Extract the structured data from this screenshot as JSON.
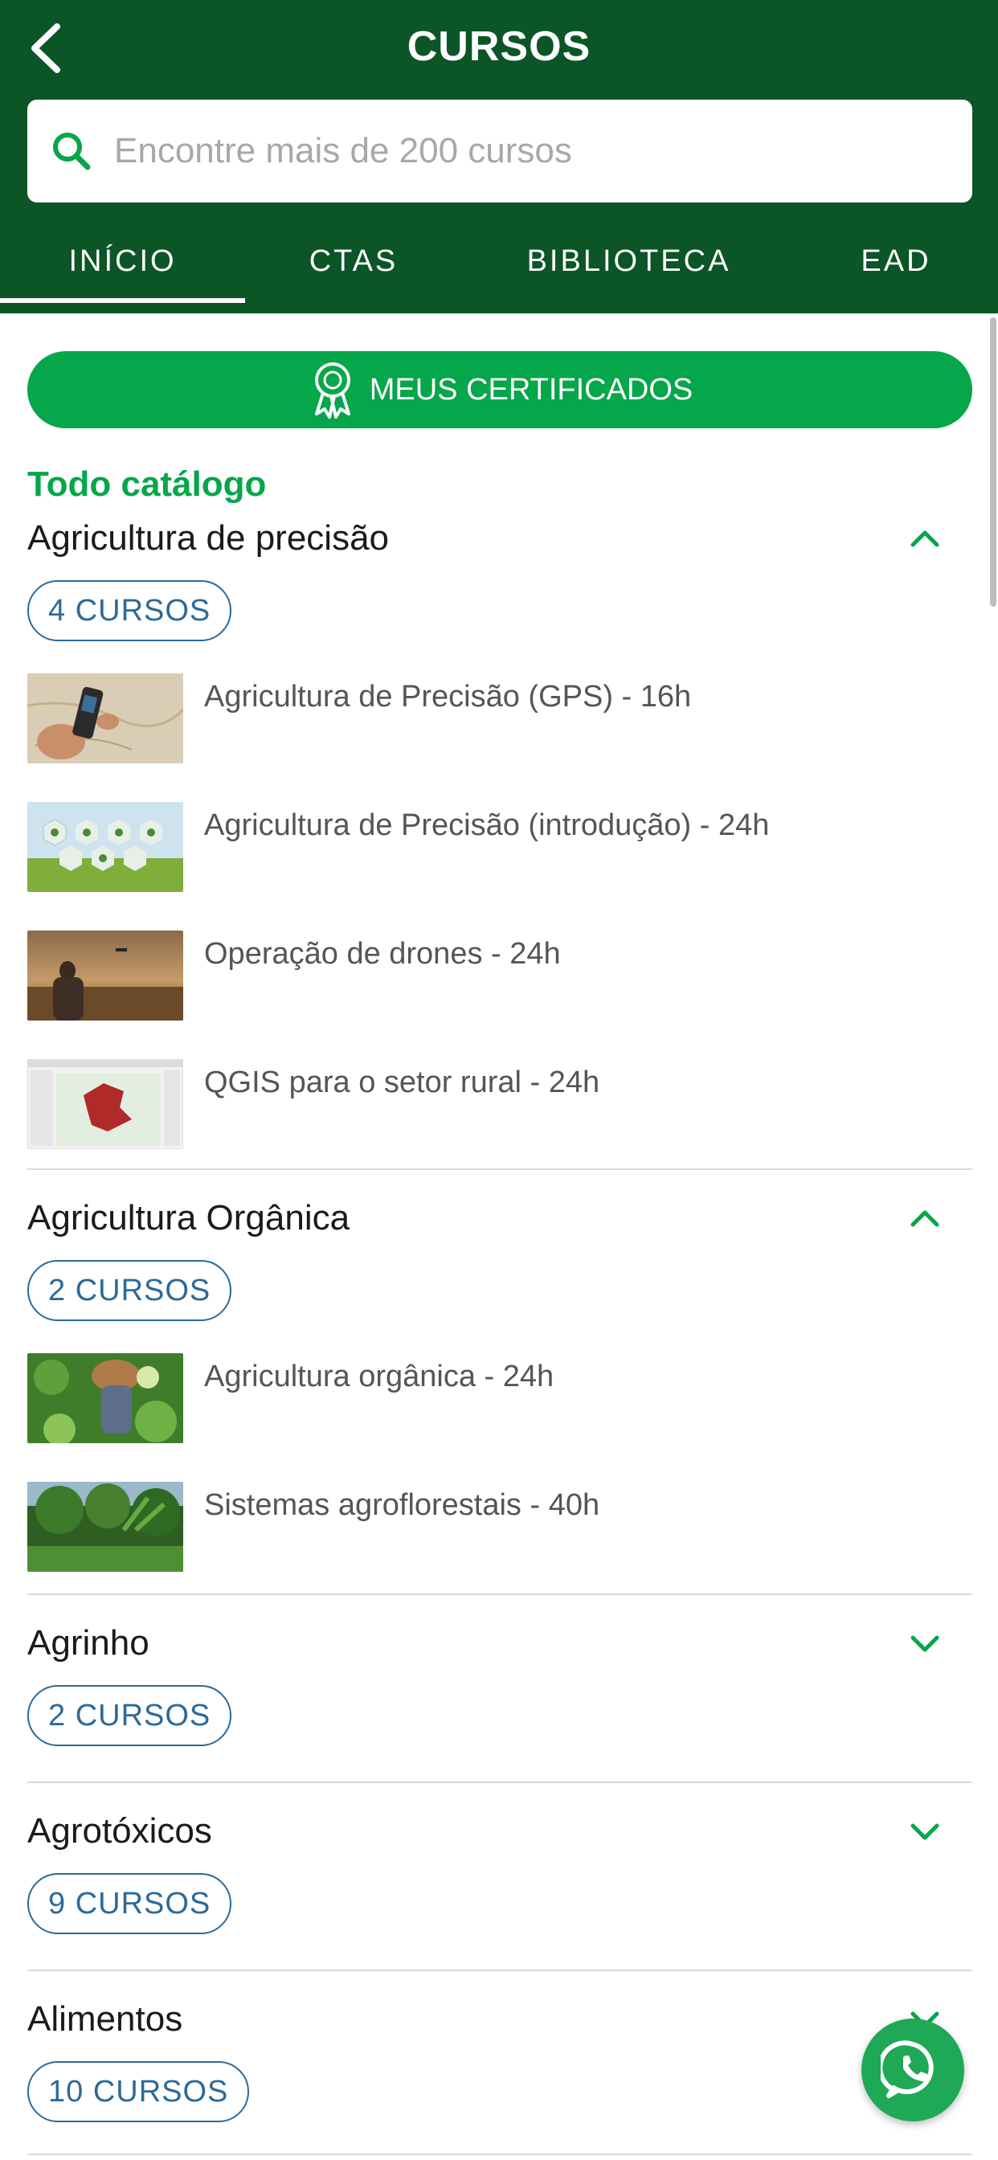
{
  "header": {
    "title": "CURSOS",
    "back_icon": "chevron-left-icon",
    "background": "#0b5527"
  },
  "search": {
    "placeholder": "Encontre mais de 200 cursos",
    "value": "",
    "icon": "search-icon"
  },
  "tabs": [
    {
      "label": "INÍCIO",
      "active": true
    },
    {
      "label": "CTAS",
      "active": false
    },
    {
      "label": "BIBLIOTECA",
      "active": false
    },
    {
      "label": "EAD",
      "active": false
    }
  ],
  "certificates_button": {
    "label": "MEUS CERTIFICADOS",
    "icon": "award-ribbon-icon",
    "color": "#06a64a"
  },
  "catalog_title": "Todo catálogo",
  "categories": [
    {
      "title": "Agricultura de precisão",
      "badge": "4 CURSOS",
      "expanded": true,
      "courses": [
        {
          "label": "Agricultura de Precisão (GPS) - 16h",
          "thumb": "gps-device-photo"
        },
        {
          "label": "Agricultura de Precisão (introdução) - 24h",
          "thumb": "precision-icons-photo"
        },
        {
          "label": "Operação de drones - 24h",
          "thumb": "drone-field-photo"
        },
        {
          "label": "QGIS para o setor rural - 24h",
          "thumb": "qgis-map-screenshot"
        }
      ]
    },
    {
      "title": "Agricultura Orgânica",
      "badge": "2 CURSOS",
      "expanded": true,
      "courses": [
        {
          "label": "Agricultura orgânica - 24h",
          "thumb": "farmer-crops-photo"
        },
        {
          "label": "Sistemas agroflorestais - 40h",
          "thumb": "agroforest-photo"
        }
      ]
    },
    {
      "title": "Agrinho",
      "badge": "2 CURSOS",
      "expanded": false,
      "courses": []
    },
    {
      "title": "Agrotóxicos",
      "badge": "9 CURSOS",
      "expanded": false,
      "courses": []
    },
    {
      "title": "Alimentos",
      "badge": "10 CURSOS",
      "expanded": false,
      "courses": []
    }
  ],
  "whatsapp_button": {
    "icon": "whatsapp-icon",
    "color": "#1fa855"
  }
}
